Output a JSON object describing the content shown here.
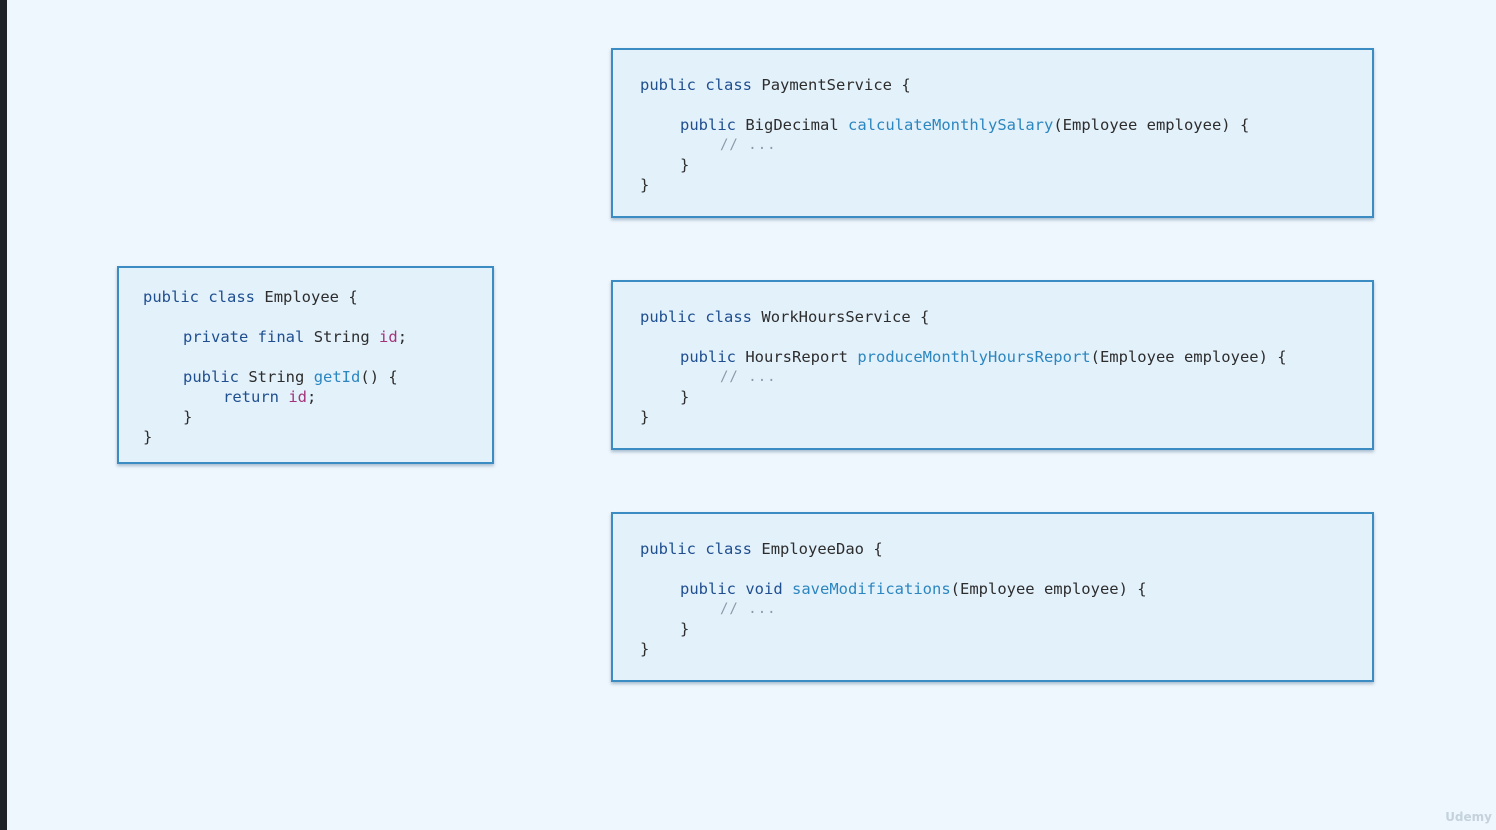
{
  "watermark": "Udemy",
  "employee": {
    "line1_kw1": "public",
    "line1_kw2": "class",
    "line1_name": "Employee",
    "line1_brace": "{",
    "line2_kw1": "private",
    "line2_kw2": "final",
    "line2_type": "String",
    "line2_field": "id",
    "line2_end": ";",
    "line3_kw": "public",
    "line3_type": "String",
    "line3_method": "getId",
    "line3_end": "() {",
    "line4_kw": "return",
    "line4_field": "id",
    "line4_end": ";",
    "line5_close": "}",
    "line6_close": "}"
  },
  "payment_service": {
    "class_kw1": "public",
    "class_kw2": "class",
    "class_name": "PaymentService",
    "class_brace": "{",
    "method_kw": "public",
    "return_type": "BigDecimal",
    "method_name": "calculateMonthlySalary",
    "params": "(Employee employee) {",
    "comment": "// ...",
    "method_close": "}",
    "class_close": "}"
  },
  "work_hours_service": {
    "class_kw1": "public",
    "class_kw2": "class",
    "class_name": "WorkHoursService",
    "class_brace": "{",
    "method_kw": "public",
    "return_type": "HoursReport",
    "method_name": "produceMonthlyHoursReport",
    "params": "(Employee employee) {",
    "comment": "// ...",
    "method_close": "}",
    "class_close": "}"
  },
  "employee_dao": {
    "class_kw1": "public",
    "class_kw2": "class",
    "class_name": "EmployeeDao",
    "class_brace": "{",
    "method_kw": "public",
    "return_type": "void",
    "method_name": "saveModifications",
    "params": "(Employee employee) {",
    "comment": "// ...",
    "method_close": "}",
    "class_close": "}"
  },
  "colors": {
    "background": "#eef7fd",
    "box_fill": "#e3f1fb",
    "box_border": "#3a8cc2",
    "keyword": "#1f4f8f",
    "method": "#2c86bf",
    "field": "#a3337a",
    "comment": "#8a9aa8"
  }
}
